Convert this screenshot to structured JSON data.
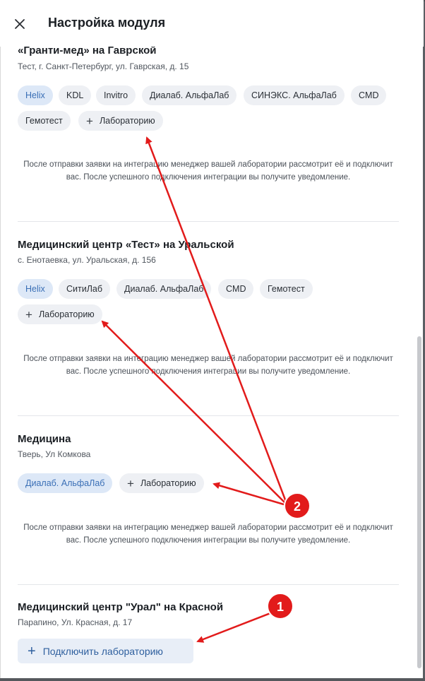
{
  "header": {
    "title": "Настройка модуля"
  },
  "sections": [
    {
      "title": "«Гранти-мед» на Гаврской",
      "address": "Тест, г. Санкт-Петербург, ул. Гаврская, д. 15",
      "labs": [
        "Helix",
        "KDL",
        "Invitro",
        "Диалаб. АльфаЛаб",
        "СИНЭКС. АльфаЛаб",
        "CMD",
        "Гемотест"
      ],
      "add_label": "Лабораторию",
      "note": "После отправки заявки на интеграцию менеджер вашей лаборатории рассмотрит её и подключит вас. После успешного подключения интеграции вы получите уведомление."
    },
    {
      "title": "Медицинский центр «Тест» на Уральской",
      "address": "с. Енотаевка, ул. Уральская, д. 156",
      "labs": [
        "Helix",
        "СитиЛаб",
        "Диалаб. АльфаЛаб",
        "CMD",
        "Гемотест"
      ],
      "add_label": "Лабораторию",
      "note": "После отправки заявки на интеграцию менеджер вашей лаборатории рассмотрит её и подключит вас. После успешного подключения интеграции вы получите уведомление."
    },
    {
      "title": "Медицина",
      "address": "Тверь, Ул Комкова",
      "labs": [
        "Диалаб. АльфаЛаб"
      ],
      "add_label": "Лабораторию",
      "note": "После отправки заявки на интеграцию менеджер вашей лаборатории рассмотрит её и подключит вас. После успешного подключения интеграции вы получите уведомление."
    },
    {
      "title": "Медицинский центр \"Урал\" на Красной",
      "address": "Парапино, Ул. Красная, д. 17",
      "connect_label": "Подключить лабораторию"
    }
  ],
  "annotations": {
    "marker_1": "1",
    "marker_2": "2"
  },
  "colors": {
    "accent": "#2e5f9e",
    "selected_chip_bg": "#dde8f7",
    "arrow": "#e21b1b"
  },
  "icons": {
    "close": "close-icon",
    "add": "plus-icon"
  }
}
